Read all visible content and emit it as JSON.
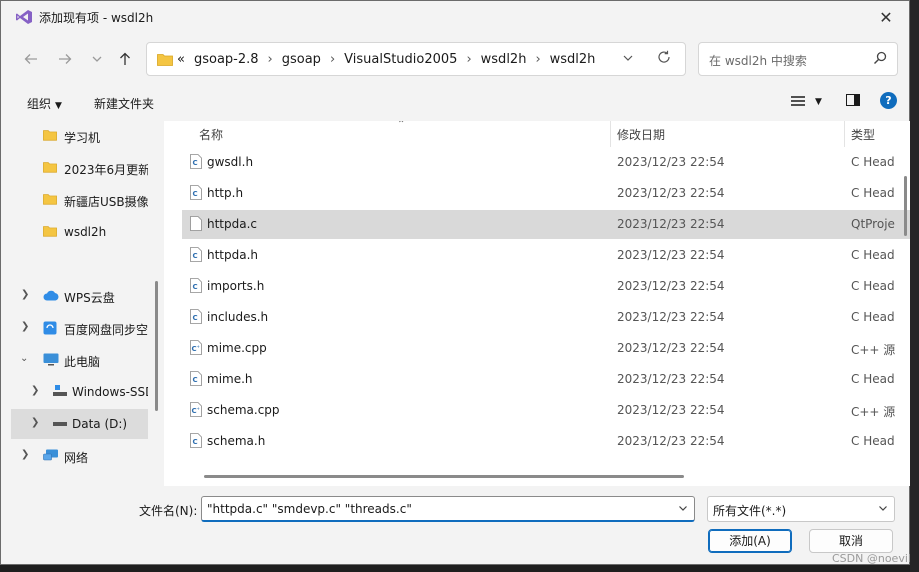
{
  "window": {
    "title": "添加现有项 - wsdl2h",
    "close_glyph": "✕"
  },
  "address": {
    "overflow": "«",
    "crumbs": [
      "gsoap-2.8",
      "gsoap",
      "VisualStudio2005",
      "wsdl2h",
      "wsdl2h"
    ],
    "separator": "›"
  },
  "search": {
    "placeholder": "在 wsdl2h 中搜索"
  },
  "toolbar": {
    "organize": "组织",
    "new_folder": "新建文件夹",
    "help": "?"
  },
  "sidebar": {
    "items": [
      {
        "label": "学习机",
        "icon": "folder-icon"
      },
      {
        "label": "2023年6月更新",
        "icon": "folder-icon"
      },
      {
        "label": "新疆店USB摄像",
        "icon": "folder-icon"
      },
      {
        "label": "wsdl2h",
        "icon": "folder-icon"
      },
      {
        "label": "WPS云盘",
        "icon": "cloud-icon"
      },
      {
        "label": "百度网盘同步空",
        "icon": "sync-icon"
      },
      {
        "label": "此电脑",
        "icon": "computer-icon"
      },
      {
        "label": "Windows-SSD",
        "icon": "drive-icon"
      },
      {
        "label": "Data (D:)",
        "icon": "drive-icon"
      },
      {
        "label": "网络",
        "icon": "network-icon"
      }
    ]
  },
  "columns": {
    "name": "名称",
    "modified": "修改日期",
    "type": "类型"
  },
  "files": [
    {
      "name": "gwsdl.h",
      "date": "2023/12/23 22:54",
      "type": "C Head",
      "icon": "c-header-icon"
    },
    {
      "name": "http.h",
      "date": "2023/12/23 22:54",
      "type": "C Head",
      "icon": "c-header-icon"
    },
    {
      "name": "httpda.c",
      "date": "2023/12/23 22:54",
      "type": "QtProje",
      "icon": "file-icon"
    },
    {
      "name": "httpda.h",
      "date": "2023/12/23 22:54",
      "type": "C Head",
      "icon": "c-header-icon"
    },
    {
      "name": "imports.h",
      "date": "2023/12/23 22:54",
      "type": "C Head",
      "icon": "c-header-icon"
    },
    {
      "name": "includes.h",
      "date": "2023/12/23 22:54",
      "type": "C Head",
      "icon": "c-header-icon"
    },
    {
      "name": "mime.cpp",
      "date": "2023/12/23 22:54",
      "type": "C++ 源",
      "icon": "cpp-source-icon"
    },
    {
      "name": "mime.h",
      "date": "2023/12/23 22:54",
      "type": "C Head",
      "icon": "c-header-icon"
    },
    {
      "name": "schema.cpp",
      "date": "2023/12/23 22:54",
      "type": "C++ 源",
      "icon": "cpp-source-icon"
    },
    {
      "name": "schema.h",
      "date": "2023/12/23 22:54",
      "type": "C Head",
      "icon": "c-header-icon"
    }
  ],
  "bottom": {
    "filename_label": "文件名(N):",
    "filename_value": "\"httpda.c\" \"smdevp.c\" \"threads.c\"",
    "filetype_value": "所有文件(*.*)",
    "add_button": "添加(A)",
    "cancel_button": "取消"
  },
  "watermark": "CSDN @noevil",
  "colors": {
    "accent": "#0f6cbd",
    "folder": "#f4c542",
    "selected_row": "#d9d9d9"
  }
}
